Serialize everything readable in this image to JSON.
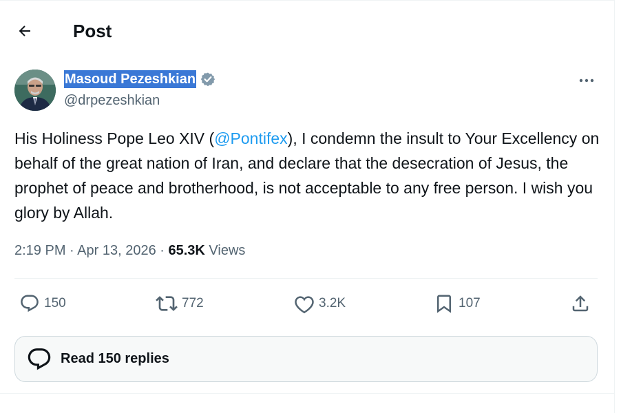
{
  "header": {
    "title": "Post",
    "back_icon": "arrow-left-icon"
  },
  "author": {
    "name": "Masoud Pezeshkian",
    "handle": "@drpezeshkian",
    "verified_icon": "verified-badge-icon",
    "avatar": "avatar-photo"
  },
  "tweet": {
    "text_before": "His Holiness Pope Leo XIV (",
    "mention": "@Pontifex",
    "text_after": "), I condemn the insult to Your Excellency on behalf of the great nation of Iran, and declare that the desecration of Jesus, the prophet of peace and brotherhood, is not acceptable to any free person. I wish you glory by Allah.",
    "mention_color": "#1d9bf0"
  },
  "meta": {
    "time": "2:19 PM",
    "sep1": " · ",
    "date": "Apr 13, 2026",
    "sep2": " · ",
    "views_count": "65.3K",
    "views_label": " Views"
  },
  "actions": {
    "replies": "150",
    "reposts": "772",
    "likes": "3.2K",
    "bookmarks": "107"
  },
  "read_replies": {
    "label": "Read 150 replies"
  },
  "colors": {
    "text_primary": "#0f1419",
    "text_secondary": "#536471",
    "accent": "#1d9bf0",
    "selection": "#3a78d6",
    "border": "#eff3f4"
  }
}
